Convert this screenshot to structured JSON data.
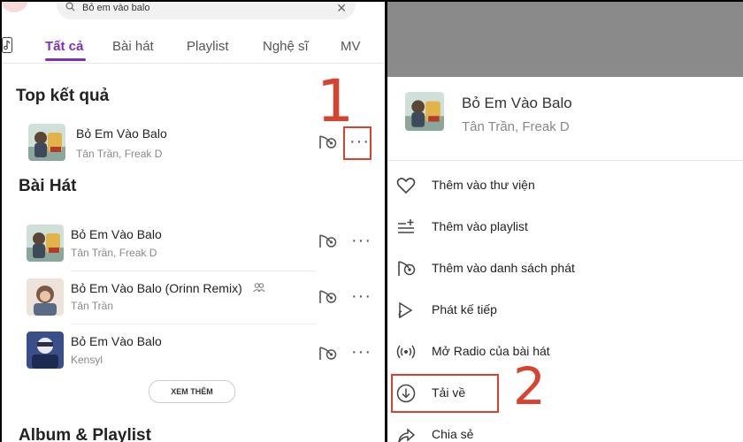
{
  "search": {
    "query": "Bỏ em vào balo"
  },
  "tabs": [
    {
      "label": "Tất cả",
      "active": true
    },
    {
      "label": "Bài hát"
    },
    {
      "label": "Playlist"
    },
    {
      "label": "Nghệ sĩ"
    },
    {
      "label": "MV"
    }
  ],
  "top_results": {
    "title": "Top kết quả",
    "item": {
      "title": "Bỏ Em Vào Balo",
      "artist": "Tân Trần, Freak D"
    }
  },
  "songs": {
    "title": "Bài Hát",
    "items": [
      {
        "title": "Bỏ Em Vào Balo",
        "artist": "Tân Trần, Freak D"
      },
      {
        "title": "Bỏ Em Vào Balo (Orinn Remix)",
        "artist": "Tân Trần"
      },
      {
        "title": "Bỏ Em Vào Balo",
        "artist": "Kensyl"
      }
    ],
    "see_more": "XEM THÊM"
  },
  "album_section": {
    "title": "Album & Playlist"
  },
  "annotations": {
    "step1": "1",
    "step2": "2",
    "color": "#d9432e"
  },
  "sheet": {
    "song_title": "Bỏ Em Vào Balo",
    "song_artist": "Tân Trần, Freak D",
    "menu": [
      {
        "label": "Thêm vào thư viện",
        "icon": "heart-icon"
      },
      {
        "label": "Thêm vào playlist",
        "icon": "add-playlist-icon"
      },
      {
        "label": "Thêm vào danh sách phát",
        "icon": "queue-icon"
      },
      {
        "label": "Phát kế tiếp",
        "icon": "play-next-icon"
      },
      {
        "label": "Mở Radio của bài hát",
        "icon": "radio-icon"
      },
      {
        "label": "Tải về",
        "icon": "download-icon"
      },
      {
        "label": "Chia sẻ",
        "icon": "share-icon"
      }
    ]
  },
  "colors": {
    "accent": "#7b2fbe",
    "annotation": "#d9432e"
  }
}
